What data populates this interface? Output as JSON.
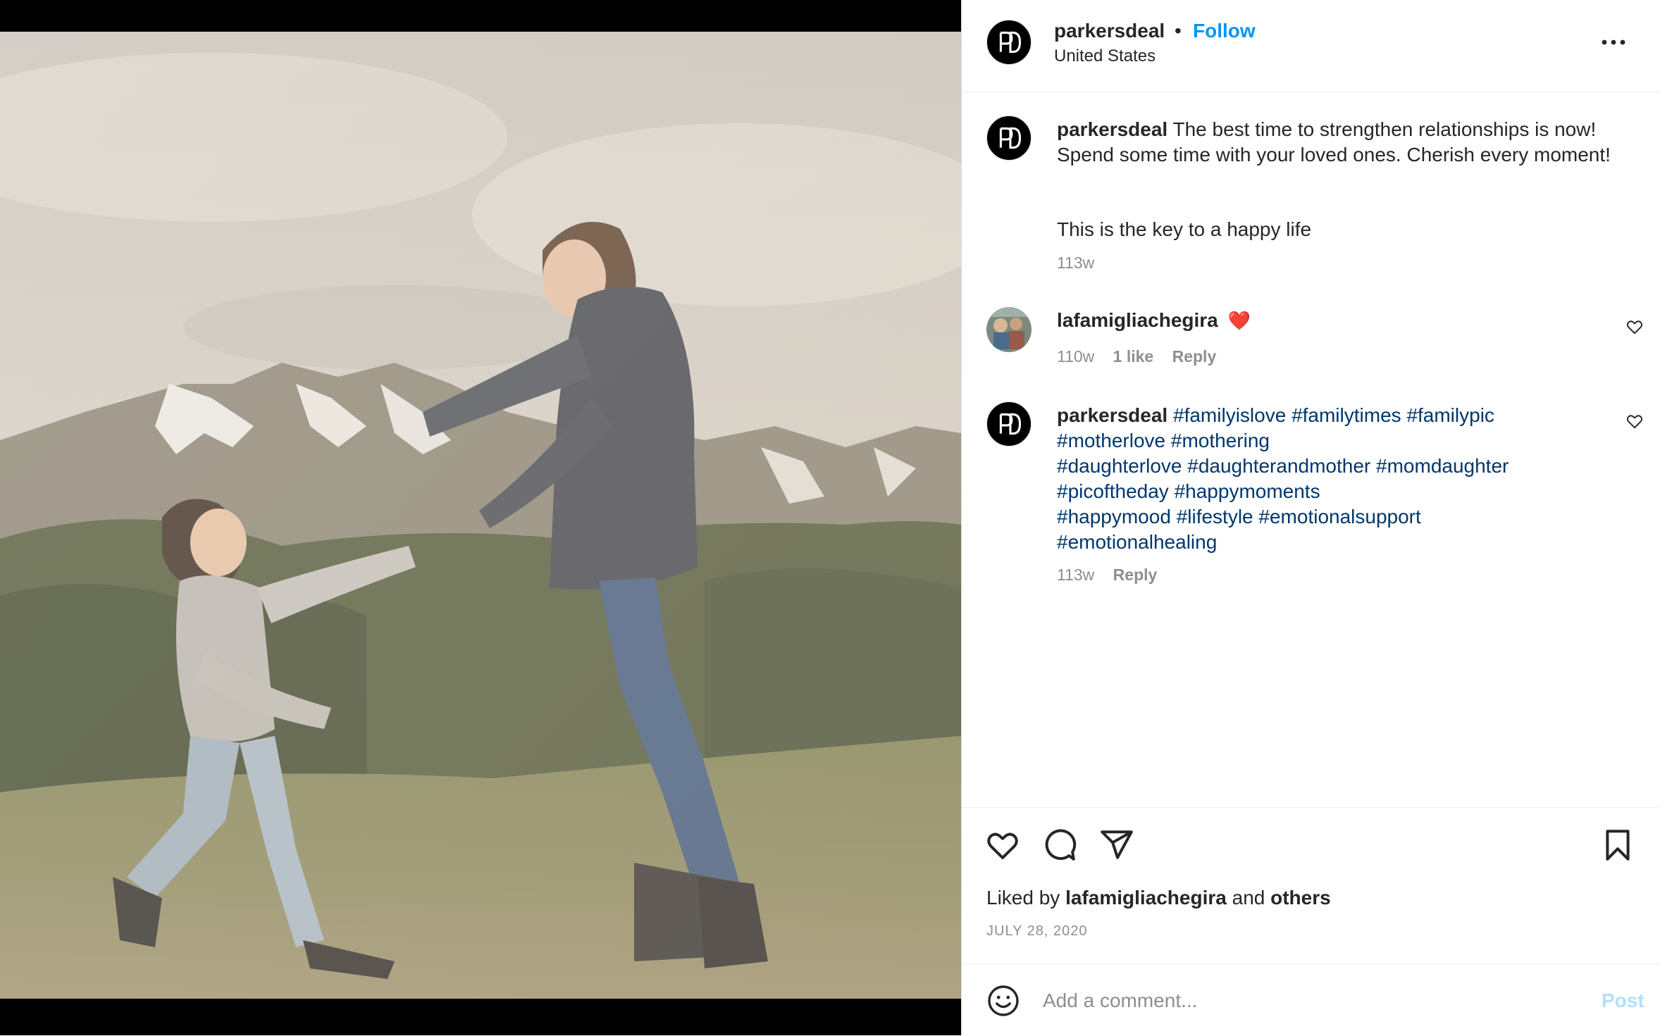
{
  "post": {
    "username": "parkersdeal",
    "separator": "•",
    "follow_label": "Follow",
    "location": "United States",
    "avatar_initials": "PD"
  },
  "caption": {
    "username": "parkersdeal",
    "text": "The best time to strengthen relationships is now! Spend some time with your loved ones. Cherish every moment!",
    "line2": "This is the key to a happy life",
    "time": "113w"
  },
  "comments": [
    {
      "username": "lafamigliachegira",
      "text": "❤️",
      "time": "110w",
      "likes": "1 like",
      "reply_label": "Reply"
    },
    {
      "username": "parkersdeal",
      "hashtags": [
        "#familyislove",
        "#familytimes",
        "#familypic",
        "#motherlove",
        "#mothering",
        "#daughterlove",
        "#daughterandmother",
        "#momdaughter",
        "#picoftheday",
        "#happymoments",
        "#happymood",
        "#lifestyle",
        "#emotionalsupport",
        "#emotionalhealing"
      ],
      "time": "113w",
      "reply_label": "Reply"
    }
  ],
  "actions": {
    "icons": [
      "heart-icon",
      "comment-icon",
      "share-icon",
      "bookmark-icon"
    ],
    "liked_prefix": "Liked by",
    "liked_user": "lafamigliachegira",
    "liked_and": "and",
    "liked_others": "others",
    "date": "JULY 28, 2020"
  },
  "add_comment": {
    "placeholder": "Add a comment...",
    "post_label": "Post"
  },
  "colors": {
    "link_blue": "#0095f6",
    "hashtag": "#00376b",
    "muted": "#8e8e8e",
    "heart_red": "#ed4956",
    "post_disabled": "#b2dffc"
  }
}
